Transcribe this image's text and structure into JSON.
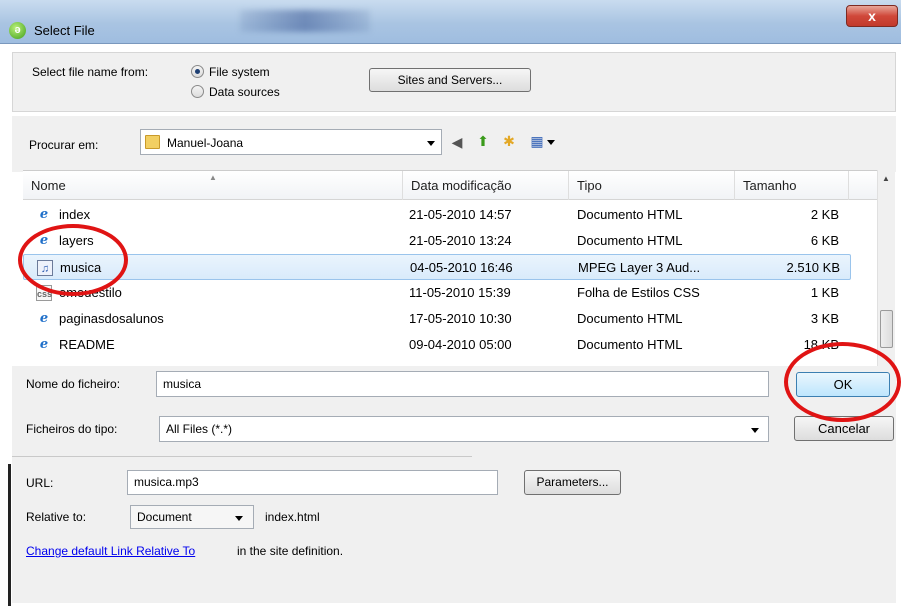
{
  "window": {
    "title": "Select File",
    "close_label": "x"
  },
  "source": {
    "label": "Select file name from:",
    "options": [
      "File system",
      "Data sources"
    ],
    "selected": "File system",
    "sites_button": "Sites and Servers..."
  },
  "nav": {
    "look_in_label": "Procurar em:",
    "folder": "Manuel-Joana",
    "icons": [
      "back-icon",
      "up-folder-icon",
      "new-folder-icon",
      "views-menu-icon"
    ]
  },
  "list": {
    "columns": [
      "Nome",
      "Data modificação",
      "Tipo",
      "Tamanho"
    ],
    "rows": [
      {
        "name": "index",
        "date": "21-05-2010 14:57",
        "type": "Documento HTML",
        "size": "2 KB",
        "icon": "ie-html-icon"
      },
      {
        "name": "layers",
        "date": "21-05-2010 13:24",
        "type": "Documento HTML",
        "size": "6 KB",
        "icon": "ie-html-icon"
      },
      {
        "name": "musica",
        "date": "04-05-2010 16:46",
        "type": "MPEG Layer 3 Aud...",
        "size": "2.510 KB",
        "icon": "mp3-file-icon",
        "selected": true
      },
      {
        "name": "omeuestilo",
        "date": "11-05-2010 15:39",
        "type": "Folha de Estilos CSS",
        "size": "1 KB",
        "icon": "css-file-icon"
      },
      {
        "name": "paginasdosalunos",
        "date": "17-05-2010 10:30",
        "type": "Documento HTML",
        "size": "3 KB",
        "icon": "ie-html-icon"
      },
      {
        "name": "README",
        "date": "09-04-2010 05:00",
        "type": "Documento HTML",
        "size": "18 KB",
        "icon": "ie-html-icon"
      }
    ]
  },
  "file": {
    "name_label": "Nome do ficheiro:",
    "name_value": "musica",
    "type_label": "Ficheiros do tipo:",
    "type_value": "All Files (*.*)",
    "ok": "OK",
    "cancel": "Cancelar"
  },
  "url": {
    "label": "URL:",
    "value": "musica.mp3",
    "parameters_button": "Parameters...",
    "relative_label": "Relative to:",
    "relative_value": "Document",
    "relative_file": "index.html",
    "link_text": "Change default Link Relative To",
    "link_suffix": " in the site definition."
  },
  "colors": {
    "annotation": "#e01414",
    "selection": "#d9ebfb",
    "link": "#0000ee"
  }
}
